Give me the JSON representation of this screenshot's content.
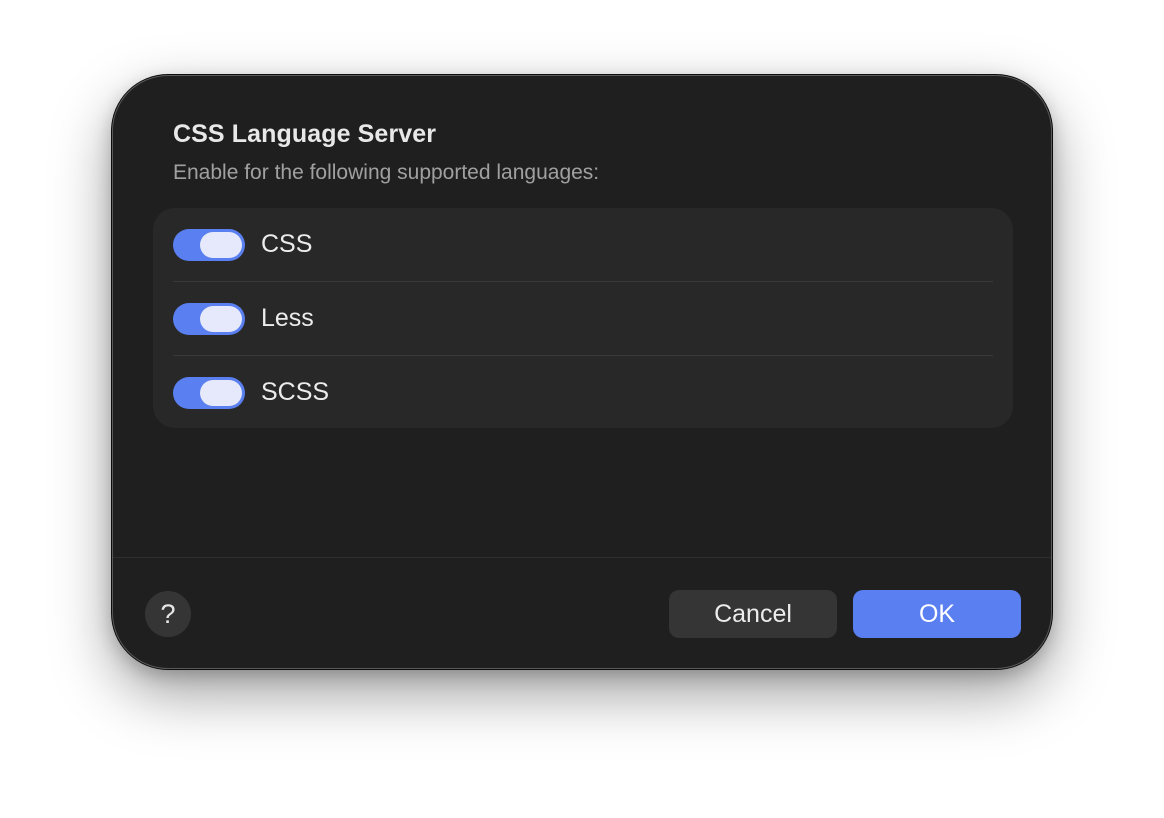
{
  "dialog": {
    "title": "CSS Language Server",
    "subtitle": "Enable for the following supported languages:",
    "accent_color": "#5a7ff0",
    "languages": [
      {
        "label": "CSS",
        "enabled": true
      },
      {
        "label": "Less",
        "enabled": true
      },
      {
        "label": "SCSS",
        "enabled": true
      }
    ]
  },
  "footer": {
    "help_label": "?",
    "cancel_label": "Cancel",
    "ok_label": "OK"
  }
}
